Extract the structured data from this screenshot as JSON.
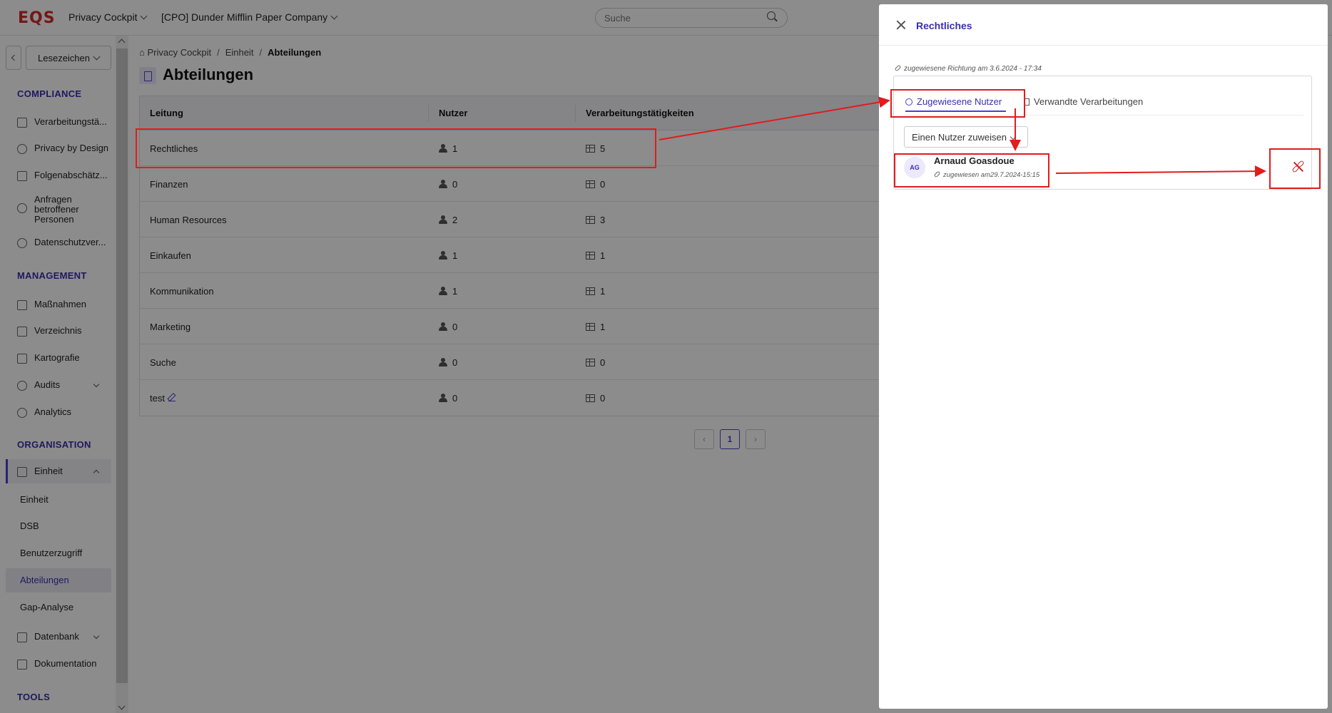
{
  "header": {
    "logo": "EQS",
    "app_switcher": "Privacy Cockpit",
    "company_switcher": "[CPO] Dunder Mifflin Paper Company",
    "search_placeholder": "Suche"
  },
  "sidebar": {
    "bookmarks_label": "Lesezeichen",
    "sections": {
      "compliance": "COMPLIANCE",
      "management": "MANAGEMENT",
      "organisation": "ORGANISATION",
      "tools": "TOOLS"
    },
    "compliance_items": [
      "Verarbeitungstä...",
      "Privacy by Design",
      "Folgenabschätz...",
      "Anfragen betroffener Personen",
      "Datenschutzver..."
    ],
    "management_items": [
      "Maßnahmen",
      "Verzeichnis",
      "Kartografie",
      "Audits",
      "Analytics"
    ],
    "organisation_group": "Einheit",
    "organisation_subitems": [
      "Einheit",
      "DSB",
      "Benutzerzugriff",
      "Abteilungen",
      "Gap-Analyse"
    ],
    "other_items": [
      "Datenbank",
      "Dokumentation"
    ],
    "active_subitem": "Abteilungen"
  },
  "breadcrumb": [
    "Privacy Cockpit",
    "Einheit",
    "Abteilungen"
  ],
  "page_title": "Abteilungen",
  "table": {
    "columns": [
      "Leitung",
      "Nutzer",
      "Verarbeitungstätigkeiten"
    ],
    "rows": [
      {
        "name": "Rechtliches",
        "users": "1",
        "activities": "5"
      },
      {
        "name": "Finanzen",
        "users": "0",
        "activities": "0"
      },
      {
        "name": "Human Resources",
        "users": "2",
        "activities": "3"
      },
      {
        "name": "Einkaufen",
        "users": "1",
        "activities": "1"
      },
      {
        "name": "Kommunikation",
        "users": "1",
        "activities": "1"
      },
      {
        "name": "Marketing",
        "users": "0",
        "activities": "1"
      },
      {
        "name": "Suche",
        "users": "0",
        "activities": "0"
      },
      {
        "name": "test",
        "users": "0",
        "activities": "0"
      }
    ]
  },
  "pagination": {
    "current": "1"
  },
  "drawer": {
    "title": "Rechtliches",
    "assigned_note": "zugewiesene Richtung am 3.6.2024 - 17:34",
    "tabs": [
      "Zugewiesene Nutzer",
      "Verwandte Verarbeitungen"
    ],
    "assign_button": "Einen Nutzer zuweisen",
    "user": {
      "initials": "AG",
      "name": "Arnaud Goasdoue",
      "meta": "zugewiesen am29.7.2024-15:15"
    }
  },
  "colors": {
    "accent": "#4b3fd1",
    "section_heading": "#3a2fb0",
    "logo": "#d32b2b",
    "annotation": "#e31b1b",
    "unlink_icon": "#c62020"
  }
}
